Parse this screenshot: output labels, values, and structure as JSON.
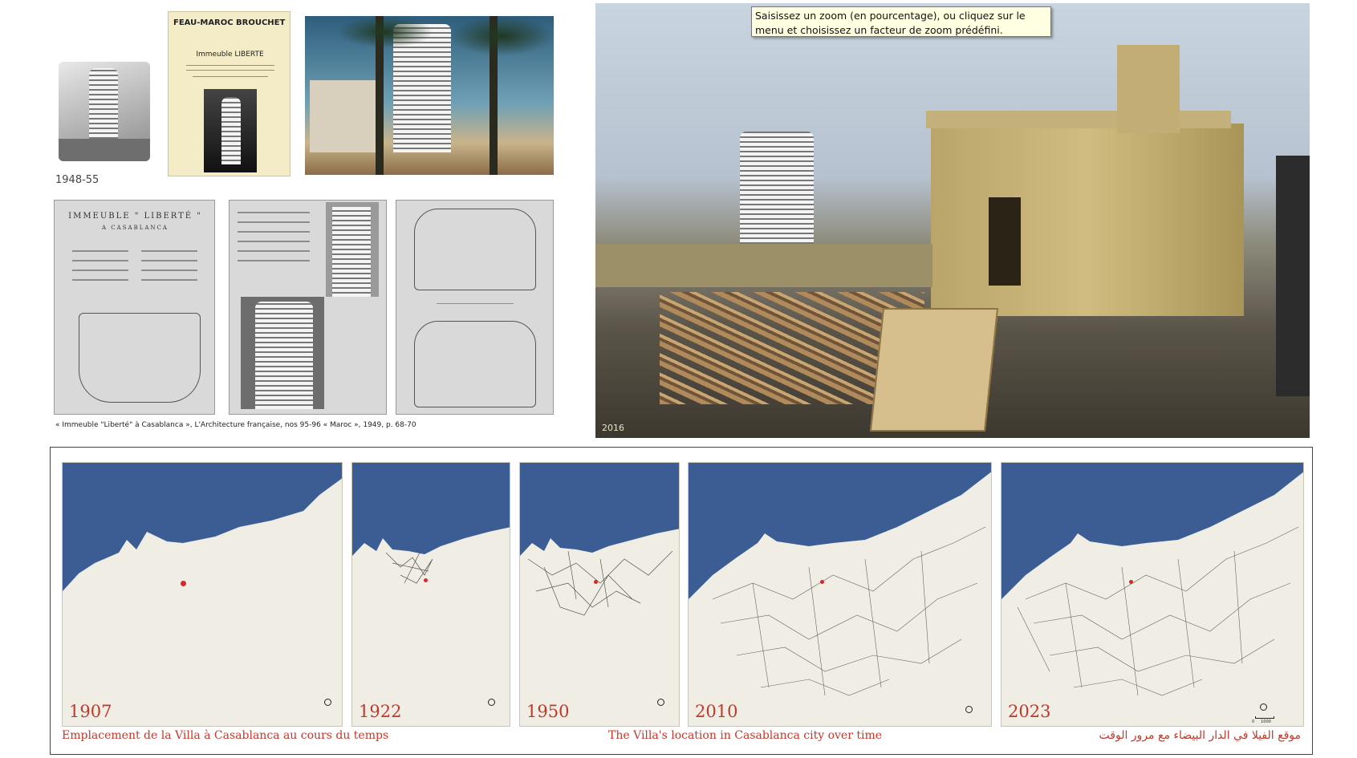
{
  "tooltip": {
    "text": "Saisissez un zoom (en pourcentage), ou cliquez sur le menu et choisissez un facteur de zoom prédéfini."
  },
  "archive": {
    "date_label": "1948-55",
    "flyer": {
      "brand_left": "FEAU-MAROC",
      "brand_right": "BROUCHET",
      "title": "Immeuble  LIBERTE"
    },
    "doc1_title": "IMMEUBLE  \" LIBERTÉ \"",
    "doc1_subtitle": "A  CASABLANCA",
    "citation": "« Immeuble \"Liberté\" à Casablanca », L'Architecture française, nos 95-96 « Maroc », 1949, p. 68-70"
  },
  "hero_photo": {
    "year_label": "2016"
  },
  "maps": {
    "panels": [
      {
        "year": "1907"
      },
      {
        "year": "1922"
      },
      {
        "year": "1950"
      },
      {
        "year": "2010"
      },
      {
        "year": "2023"
      }
    ],
    "scale_label": "0     1000",
    "colors": {
      "sea": "#3b5d93",
      "land": "#efede4",
      "marker": "#d42a2a",
      "text": "#c0392b"
    },
    "caption_fr": "Emplacement de la Villa à Casablanca au cours du temps",
    "caption_en": "The Villa's location in Casablanca city over time",
    "caption_ar": "موقع الفيلا في الدار البيضاء مع مرور الوقت"
  }
}
